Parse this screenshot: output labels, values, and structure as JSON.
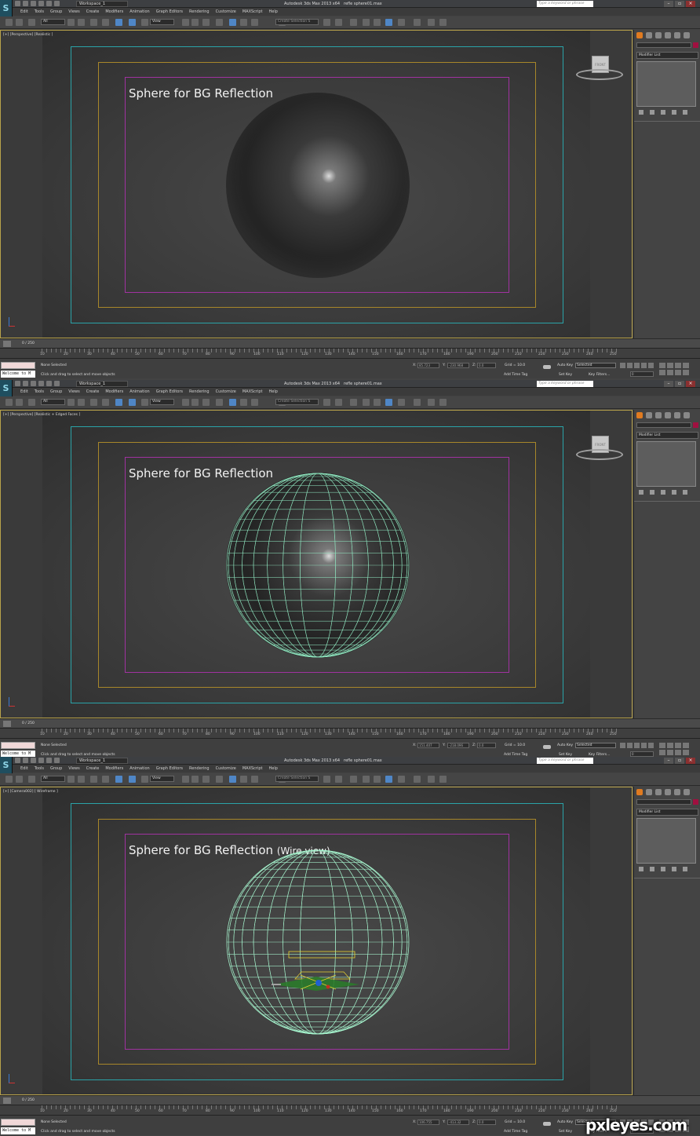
{
  "app": {
    "title": "Autodesk 3ds Max  2013 x64",
    "filename": "refle sphere01.max",
    "workspace": "Workspace_1",
    "help_search_placeholder": "Type a keyword or phrase",
    "menus": [
      "Edit",
      "Tools",
      "Group",
      "Views",
      "Create",
      "Modifiers",
      "Animation",
      "Graph Editors",
      "Rendering",
      "Customize",
      "MAXScript",
      "Help"
    ],
    "window_controls": [
      "–",
      "▫",
      "×"
    ]
  },
  "toolbar": {
    "filter": "All",
    "ref_coord": "View",
    "named_selection": "Create Selection S"
  },
  "viewports": [
    {
      "label": "[+] [Perspective] [Realistic ]",
      "caption": "Sphere for BG Reflection",
      "caption_small": "",
      "sphere_style": "shaded",
      "nav_cube_label": "FRONT",
      "coords": {
        "x": "85.723",
        "y": "-230.968",
        "z": "0.0"
      }
    },
    {
      "label": "[+] [Perspective] [Realistic + Edged Faces ]",
      "caption": "Sphere for BG Reflection",
      "caption_small": "",
      "sphere_style": "edged",
      "nav_cube_label": "FRONT",
      "coords": {
        "x": "151.407",
        "y": "-218.096",
        "z": "0.0"
      }
    },
    {
      "label": "[+] [Camera002] [ Wireframe ]",
      "caption": "Sphere for BG Reflection",
      "caption_small": "(Wire view)",
      "sphere_style": "wire",
      "nav_cube_label": "",
      "coords": {
        "x": "106.755",
        "y": "-413.32",
        "z": "0.0"
      }
    }
  ],
  "command_panel": {
    "modifier_list": "Modifier List"
  },
  "timeline": {
    "frame_counter": "0 / 250",
    "ruler_labels": [
      "10",
      "20",
      "30",
      "40",
      "50",
      "60",
      "70",
      "80",
      "90",
      "100",
      "110",
      "120",
      "130",
      "140",
      "150",
      "160",
      "170",
      "180",
      "190",
      "200",
      "210",
      "220",
      "230",
      "240",
      "250"
    ]
  },
  "status": {
    "selection": "None Selected",
    "prompt": "Click and drag to select and move objects",
    "grid": "Grid = 10.0",
    "add_time_tag": "Add Time Tag",
    "auto_key": "Auto Key",
    "set_key": "Set Key",
    "selected_dropdown": "Selected",
    "key_filters": "Key Filters...",
    "frame_value": "0",
    "welcome": "Welcome to M",
    "coord_labels": {
      "x": "X:",
      "y": "Y:",
      "z": "Z:"
    }
  },
  "watermark": "pxleyes.com",
  "colors": {
    "safe_frame_outer": "#2aa3a8",
    "safe_frame_mid": "#a8872a",
    "safe_frame_inner": "#a032a0",
    "wireframe": "#9ff0c8",
    "viewport_active_border": "#b8a24a",
    "create_tab": "#e07b20"
  }
}
